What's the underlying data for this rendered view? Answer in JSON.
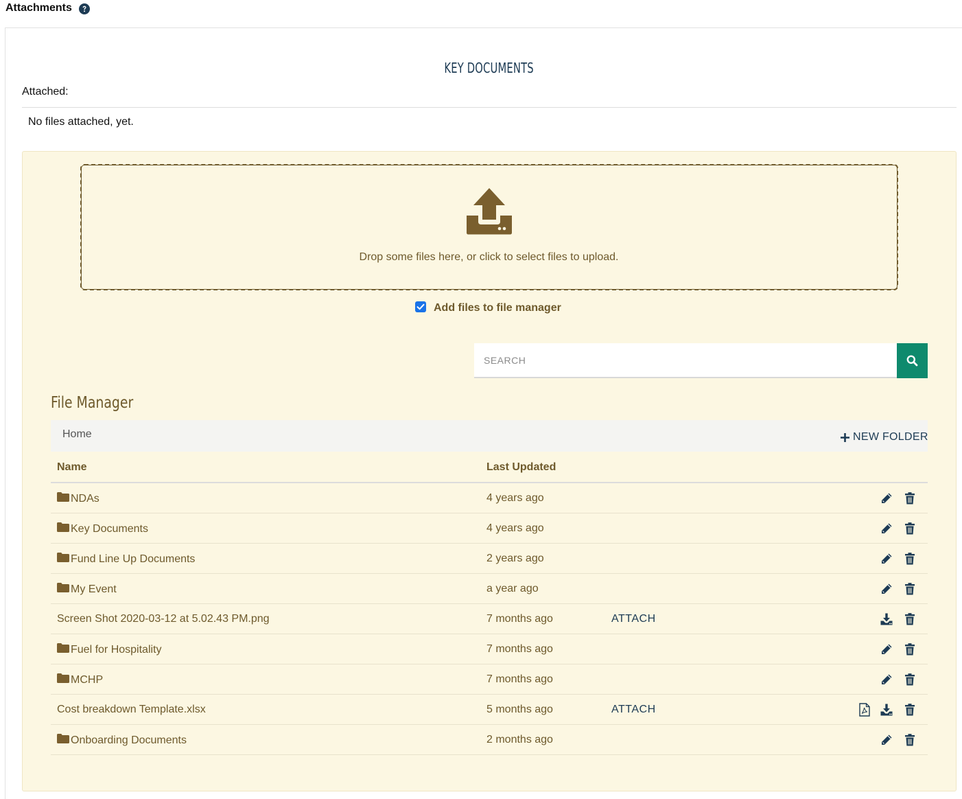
{
  "header": {
    "title": "Attachments",
    "help_icon": "question-circle-icon"
  },
  "key_documents": {
    "title": "KEY DOCUMENTS",
    "attached_label": "Attached:",
    "no_files_text": "No files attached, yet."
  },
  "upload": {
    "dropzone_text": "Drop some files here, or click to select files to upload.",
    "add_to_manager_label": "Add files to file manager",
    "add_to_manager_checked": true
  },
  "search": {
    "placeholder": "SEARCH",
    "value": ""
  },
  "file_manager": {
    "title": "File Manager",
    "breadcrumb_home": "Home",
    "new_folder_label": "NEW FOLDER",
    "columns": {
      "name": "Name",
      "last_updated": "Last Updated"
    },
    "rows": [
      {
        "name": "NDAs",
        "type": "folder",
        "updated": "4 years ago",
        "attach": ""
      },
      {
        "name": "Key Documents",
        "type": "folder",
        "updated": "4 years ago",
        "attach": ""
      },
      {
        "name": "Fund Line Up Documents",
        "type": "folder",
        "updated": "2 years ago",
        "attach": ""
      },
      {
        "name": "My Event",
        "type": "folder",
        "updated": "a year ago",
        "attach": ""
      },
      {
        "name": "Screen Shot 2020-03-12 at 5.02.43 PM.png",
        "type": "file",
        "updated": "7 months ago",
        "attach": "ATTACH"
      },
      {
        "name": "Fuel for Hospitality",
        "type": "folder",
        "updated": "7 months ago",
        "attach": ""
      },
      {
        "name": "MCHP",
        "type": "folder",
        "updated": "7 months ago",
        "attach": ""
      },
      {
        "name": "Cost breakdown Template.xlsx",
        "type": "file",
        "updated": "5 months ago",
        "attach": "ATTACH",
        "pdf": true
      },
      {
        "name": "Onboarding Documents",
        "type": "folder",
        "updated": "2 months ago",
        "attach": ""
      }
    ]
  },
  "colors": {
    "panel_bg": "#fcf7e2",
    "brown_text": "#6e5a2c",
    "navy": "#1d3b54",
    "search_button": "#0e8a6d"
  }
}
